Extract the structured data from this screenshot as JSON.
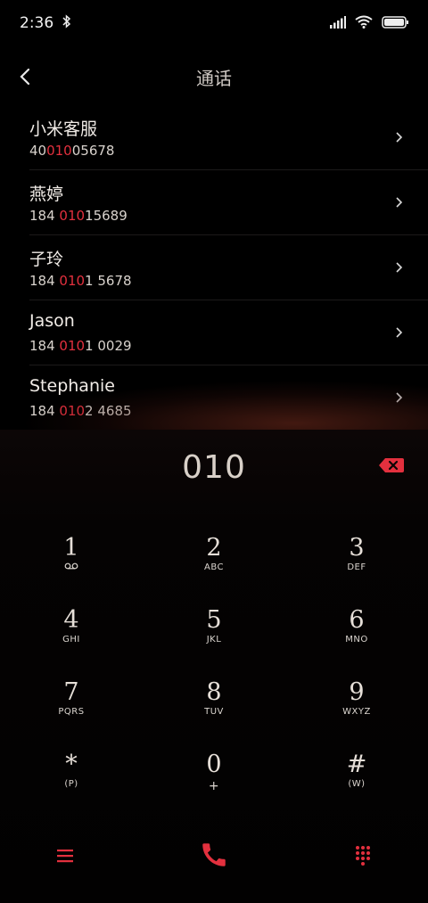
{
  "status_bar": {
    "time": "2:36",
    "icons": [
      "bluetooth-icon",
      "signal-icon",
      "wifi-icon",
      "battery-icon"
    ]
  },
  "header": {
    "title": "通话",
    "back_icon": "back-arrow-icon"
  },
  "results": [
    {
      "name": "小米客服",
      "number_pre": "40",
      "number_hl": "010",
      "number_post": "05678"
    },
    {
      "name": "燕婷",
      "number_pre": "184 ",
      "number_hl": "010",
      "number_post": "15689"
    },
    {
      "name": "子玲",
      "number_pre": "184 ",
      "number_hl": "010",
      "number_post": "1 5678"
    },
    {
      "name": "Jason",
      "number_pre": "184 ",
      "number_hl": "010",
      "number_post": "1 0029"
    },
    {
      "name": "Stephanie",
      "number_pre": "184 ",
      "number_hl": "010",
      "number_post": "2 4685"
    }
  ],
  "dialer": {
    "input": "010",
    "keys": [
      {
        "digit": "1",
        "letters": ""
      },
      {
        "digit": "2",
        "letters": "ABC"
      },
      {
        "digit": "3",
        "letters": "DEF"
      },
      {
        "digit": "4",
        "letters": "GHI"
      },
      {
        "digit": "5",
        "letters": "JKL"
      },
      {
        "digit": "6",
        "letters": "MNO"
      },
      {
        "digit": "7",
        "letters": "PQRS"
      },
      {
        "digit": "8",
        "letters": "TUV"
      },
      {
        "digit": "9",
        "letters": "WXYZ"
      },
      {
        "digit": "*",
        "letters": "(P)"
      },
      {
        "digit": "0",
        "letters": "+"
      },
      {
        "digit": "#",
        "letters": "(W)"
      }
    ]
  },
  "colors": {
    "accent": "#e3303e",
    "background": "#000000"
  }
}
